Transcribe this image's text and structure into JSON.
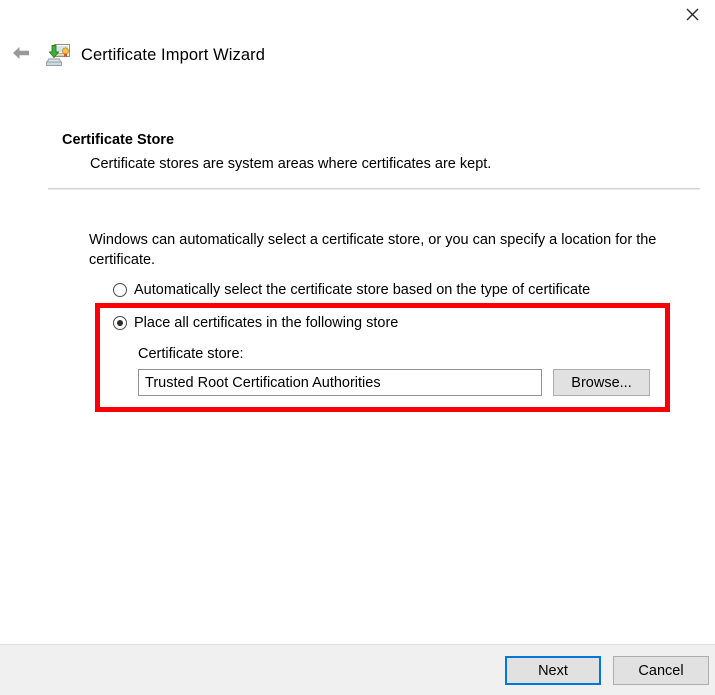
{
  "window": {
    "title": "Certificate Import Wizard",
    "close_icon": "close-icon",
    "back_icon": "back-arrow-icon",
    "app_icon": "certificate-import-icon"
  },
  "page": {
    "heading": "Certificate Store",
    "subheading": "Certificate stores are system areas where certificates are kept.",
    "description": "Windows can automatically select a certificate store, or you can specify a location for the certificate."
  },
  "options": {
    "selected": "place_all",
    "auto": {
      "label": "Automatically select the certificate store based on the type of certificate",
      "checked": false
    },
    "place_all": {
      "label": "Place all certificates in the following store",
      "checked": true
    }
  },
  "certificate_store": {
    "label": "Certificate store:",
    "value": "Trusted Root Certification Authorities",
    "placeholder": "",
    "browse_label": "Browse..."
  },
  "footer": {
    "next_label": "Next",
    "cancel_label": "Cancel"
  },
  "annotation": {
    "highlight_color": "#fb0007"
  }
}
